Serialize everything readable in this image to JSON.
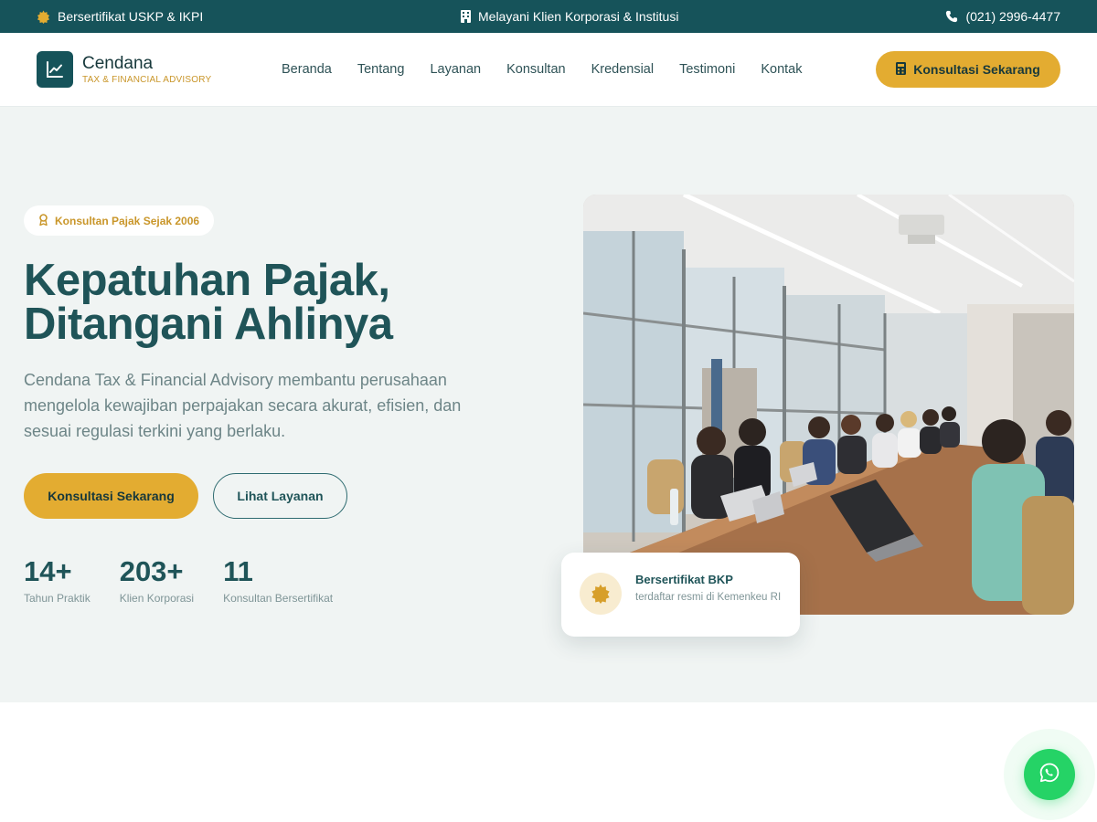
{
  "topbar": {
    "certified": "Bersertifikat USKP & IKPI",
    "clients": "Melayani Klien Korporasi & Institusi",
    "phone": "(021) 2996-4477"
  },
  "brand": {
    "name": "Cendana",
    "tagline": "TAX & FINANCIAL ADVISORY"
  },
  "nav": [
    "Beranda",
    "Tentang",
    "Layanan",
    "Konsultan",
    "Kredensial",
    "Testimoni",
    "Kontak"
  ],
  "header_cta": "Konsultasi Sekarang",
  "hero": {
    "badge": "Konsultan Pajak Sejak 2006",
    "title_line1": "Kepatuhan Pajak,",
    "title_line2": "Ditangani Ahlinya",
    "description": "Cendana Tax & Financial Advisory membantu perusahaan mengelola kewajiban perpajakan secara akurat, efisien, dan sesuai regulasi terkini yang berlaku.",
    "primary_button": "Konsultasi Sekarang",
    "secondary_button": "Lihat Layanan",
    "stats": [
      {
        "value": "14+",
        "label": "Tahun Praktik"
      },
      {
        "value": "203+",
        "label": "Klien Korporasi"
      },
      {
        "value": "11",
        "label": "Konsultan Bersertifikat"
      }
    ]
  },
  "cert_card": {
    "title": "Bersertifikat BKP",
    "subtitle": "terdaftar resmi di Kemenkeu RI"
  },
  "colors": {
    "primary": "#16535a",
    "accent": "#e3ac31",
    "whatsapp": "#25d366"
  },
  "icons": {
    "topbar_certified": "badge-icon",
    "topbar_clients": "building-icon",
    "topbar_phone": "phone-icon",
    "logo": "chart-line-icon",
    "header_cta": "calculator-icon",
    "hero_badge": "award-icon",
    "cert_card": "seal-icon",
    "floating": "whatsapp-icon"
  }
}
